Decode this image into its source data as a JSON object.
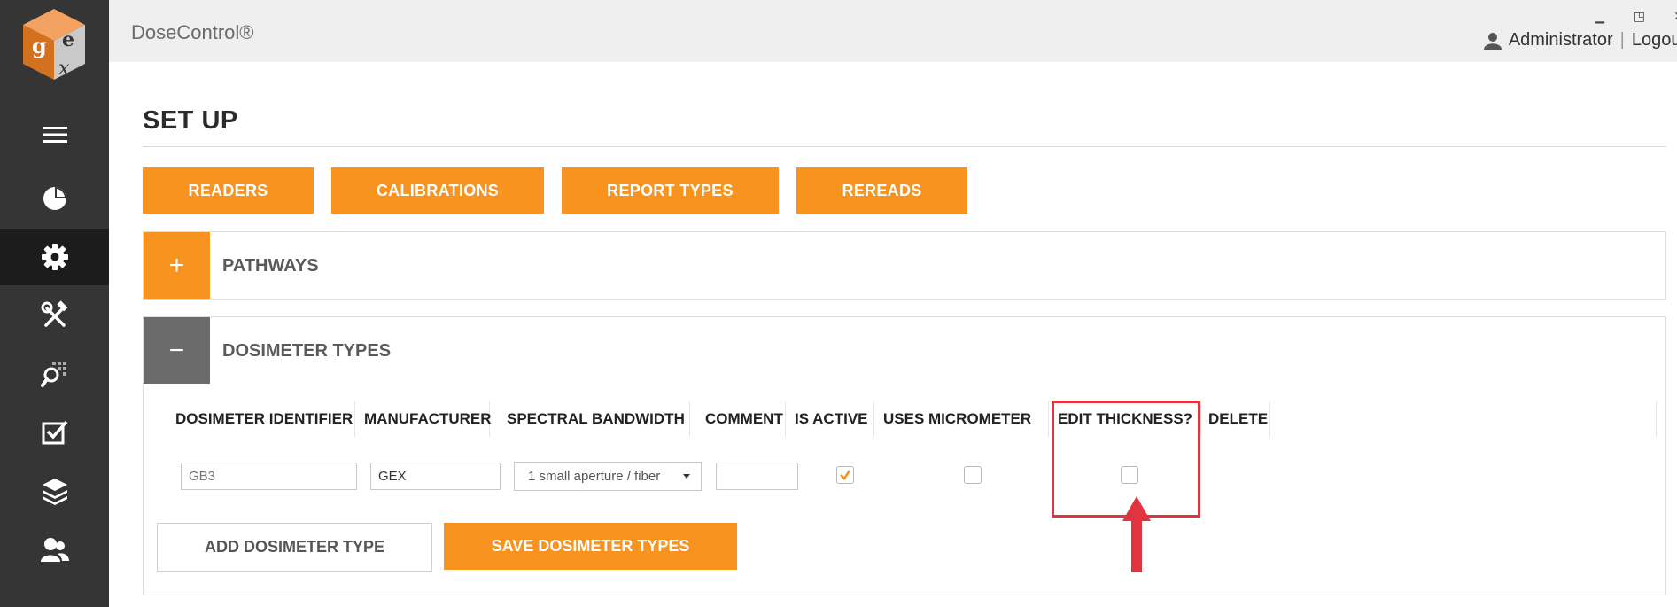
{
  "app": {
    "title": "DoseControl®",
    "window_buttons": [
      "▁",
      "◳",
      "✕"
    ]
  },
  "user": {
    "name": "Administrator",
    "separator": "|",
    "logout_label": "Logout"
  },
  "sidebar": {
    "items": [
      {
        "name": "menu",
        "icon": "hamburger-icon"
      },
      {
        "name": "dashboard",
        "icon": "pie-chart-icon"
      },
      {
        "name": "setup",
        "icon": "gear-icon",
        "active": true
      },
      {
        "name": "tools",
        "icon": "tools-icon"
      },
      {
        "name": "search",
        "icon": "search-grid-icon"
      },
      {
        "name": "tasks",
        "icon": "checkbox-icon"
      },
      {
        "name": "layers",
        "icon": "layers-icon"
      },
      {
        "name": "users",
        "icon": "users-icon"
      }
    ]
  },
  "page": {
    "title": "SET UP",
    "tabs": [
      "READERS",
      "CALIBRATIONS",
      "REPORT TYPES",
      "REREADS"
    ]
  },
  "pathways_panel": {
    "toggle": "+",
    "title": "PATHWAYS"
  },
  "dosimeter_panel": {
    "toggle": "−",
    "title": "DOSIMETER TYPES",
    "columns": [
      "DOSIMETER IDENTIFIER",
      "MANUFACTURER",
      "SPECTRAL BANDWIDTH",
      "COMMENT",
      "IS ACTIVE",
      "USES MICROMETER",
      "EDIT THICKNESS?",
      "DELETE"
    ],
    "row": {
      "identifier_placeholder": "GB3",
      "manufacturer": "GEX",
      "spectral_bandwidth": "1 small aperture / fiber",
      "comment": "",
      "is_active": true,
      "uses_micrometer": false,
      "edit_thickness": false
    },
    "add_button": "ADD DOSIMETER TYPE",
    "save_button": "SAVE DOSIMETER TYPES"
  },
  "colors": {
    "accent": "#f7931e",
    "sidebar": "#353535",
    "highlight": "#e0353f"
  }
}
